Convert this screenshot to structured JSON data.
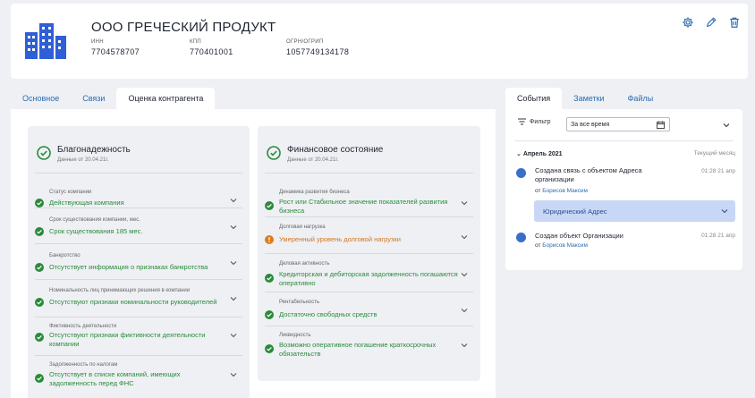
{
  "company": {
    "name": "ООО ГРЕЧЕСКИЙ ПРОДУКТ",
    "inn_label": "ИНН",
    "inn": "7704578707",
    "kpp_label": "КПП",
    "kpp": "770401001",
    "ogrn_label": "ОГРН/ОГРИП",
    "ogrn": "1057749134178"
  },
  "left_tabs": [
    {
      "label": "Основное"
    },
    {
      "label": "Связи"
    },
    {
      "label": "Оценка контрагента"
    }
  ],
  "reliability": {
    "title": "Благонадежность",
    "subtitle": "Данные от 20.04.21г.",
    "items": [
      {
        "label": "Статус компании",
        "value": "Действующая компания"
      },
      {
        "label": "Срок существования компании, мес.",
        "value": "Срок существования 185 мес."
      },
      {
        "label": "Банкротство",
        "value": "Отсутствует информация о признаках банкротства"
      },
      {
        "label": "Номинальность лиц принимающих решения в компании",
        "value": "Отсутствуют признаки номинальности руководителей"
      },
      {
        "label": "Фиктивность деятельности",
        "value": "Отсутствуют признаки фиктивности деятельности компании"
      },
      {
        "label": "Задолженность по налогам",
        "value": "Отсутствует в списке компаний, имеющих задолженность перед ФНС"
      }
    ]
  },
  "finance": {
    "title": "Финансовое состояние",
    "subtitle": "Данные от 20.04.21г.",
    "items": [
      {
        "label": "Динамика развития бизнеса",
        "value": "Рост или Стабильное значение показателей развития бизнеса"
      },
      {
        "label": "Долговая нагрузка",
        "value": "Умеренный уровень долговой нагрузки"
      },
      {
        "label": "Деловая активность",
        "value": "Кредиторская и дебиторская задолженность погашаются оперативно"
      },
      {
        "label": "Рентабельность",
        "value": "Достаточно свободных средств"
      },
      {
        "label": "Ликвидность",
        "value": "Возможно оперативное погашение краткосрочных обязательств"
      }
    ]
  },
  "right_tabs": [
    {
      "label": "События"
    },
    {
      "label": "Заметки"
    },
    {
      "label": "Файлы"
    }
  ],
  "events_panel": {
    "filter_label": "Фильтр",
    "filter_value": "За все время",
    "month": "Апрель 2021",
    "month_right": "Текущий месяц",
    "events": [
      {
        "text": "Создана связь с объектом Адреса организации",
        "time": "01:28 21 апр",
        "by_prefix": "от",
        "by_name": "Борисов Максим"
      },
      {
        "text": "Создан объект Организации",
        "time": "01:28 21 апр",
        "by_prefix": "от",
        "by_name": "Борисов Максим"
      }
    ],
    "chip_label": "Юридический Адрес"
  },
  "colors": {
    "accent": "#2c6cb0",
    "ok_green": "#2a8a3a",
    "warn_orange": "#e07b1a",
    "logo_blue": "#2f5fd6"
  }
}
